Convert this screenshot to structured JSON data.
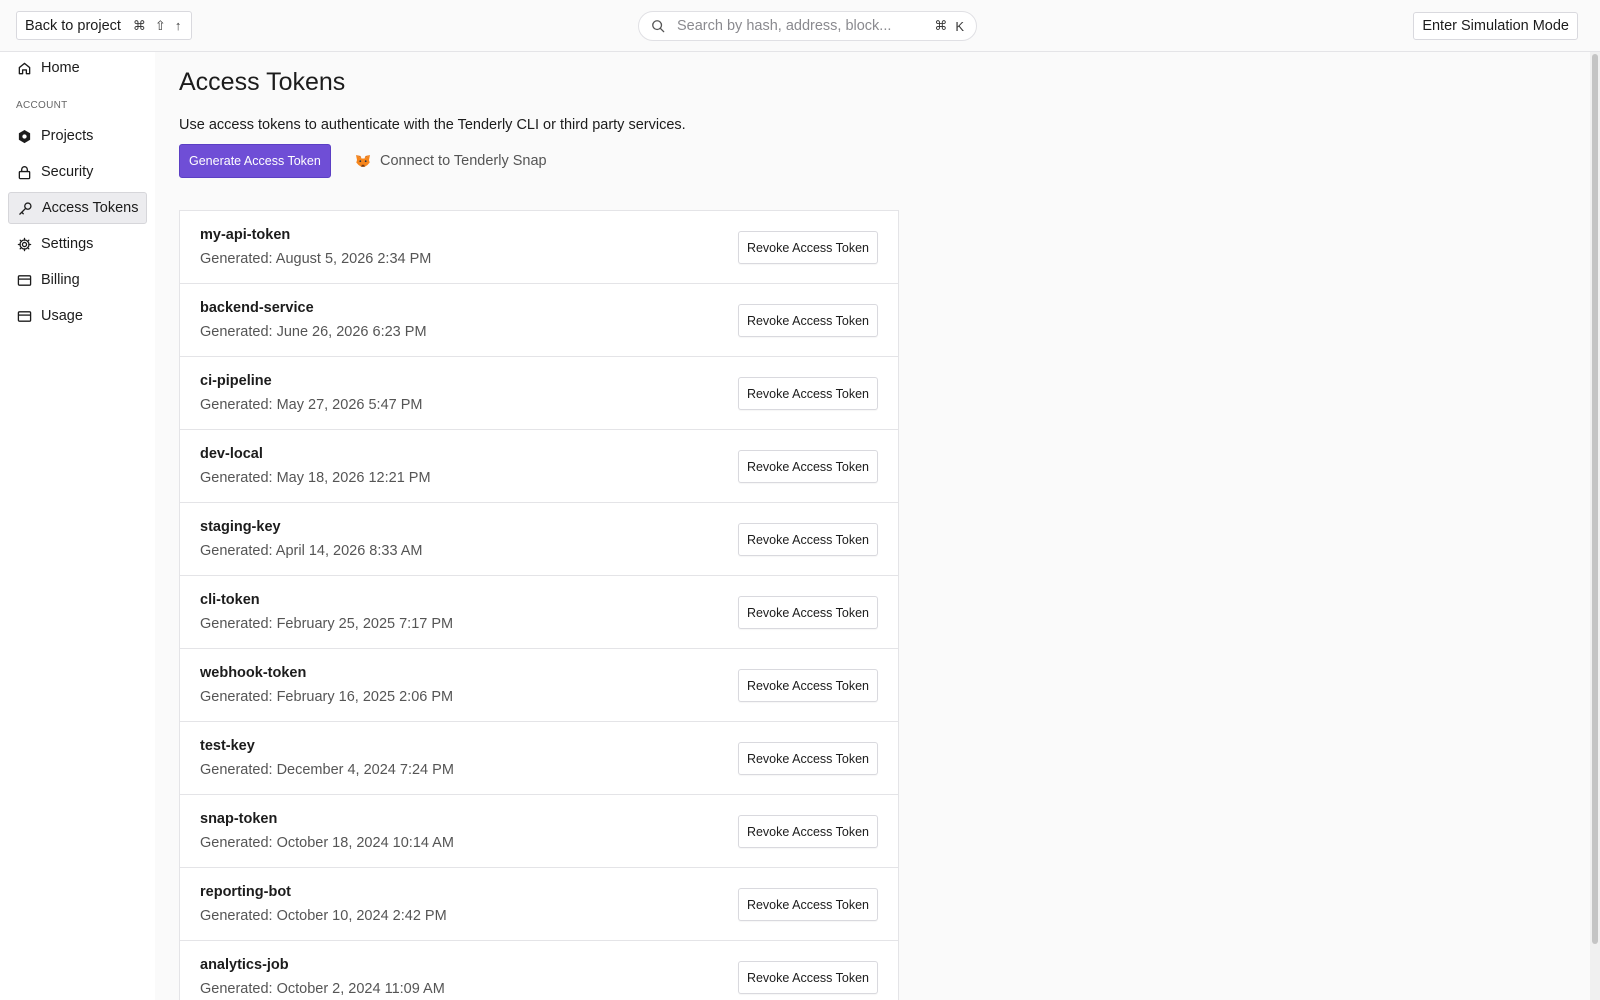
{
  "topbar": {
    "back_label": "Back to project",
    "back_shortcut": [
      "⌘",
      "⇧",
      "↑"
    ],
    "search_placeholder": "Search by hash, address, block...",
    "search_shortcut": [
      "⌘",
      "K"
    ],
    "simulation_label": "Enter Simulation Mode"
  },
  "sidebar": {
    "home": {
      "label": "Home",
      "icon": "home-icon"
    },
    "section_label": "ACCOUNT",
    "items": [
      {
        "label": "Projects",
        "icon": "hexagon-icon"
      },
      {
        "label": "Security",
        "icon": "lock-icon"
      },
      {
        "label": "Access Tokens",
        "icon": "key-icon",
        "active": true
      },
      {
        "label": "Settings",
        "icon": "gear-icon"
      },
      {
        "label": "Billing",
        "icon": "credit-card-icon"
      },
      {
        "label": "Usage",
        "icon": "credit-card-icon"
      }
    ]
  },
  "main": {
    "title": "Access Tokens",
    "description": "Use access tokens to authenticate with the Tenderly CLI or third party services.",
    "generate_label": "Generate Access Token",
    "snap_label": "Connect to Tenderly Snap",
    "revoke_label": "Revoke Access Token",
    "tokens": [
      {
        "name": "my-api-token",
        "generated": "Generated: August 5, 2026 2:34 PM"
      },
      {
        "name": "backend-service",
        "generated": "Generated: June 26, 2026 6:23 PM"
      },
      {
        "name": "ci-pipeline",
        "generated": "Generated: May 27, 2026 5:47 PM"
      },
      {
        "name": "dev-local",
        "generated": "Generated: May 18, 2026 12:21 PM"
      },
      {
        "name": "staging-key",
        "generated": "Generated: April 14, 2026 8:33 AM"
      },
      {
        "name": "cli-token",
        "generated": "Generated: February 25, 2025 7:17 PM"
      },
      {
        "name": "webhook-token",
        "generated": "Generated: February 16, 2025 2:06 PM"
      },
      {
        "name": "test-key",
        "generated": "Generated: December 4, 2024 7:24 PM"
      },
      {
        "name": "snap-token",
        "generated": "Generated: October 18, 2024 10:14 AM"
      },
      {
        "name": "reporting-bot",
        "generated": "Generated: October 10, 2024 2:42 PM"
      },
      {
        "name": "analytics-job",
        "generated": "Generated: October 2, 2024 11:09 AM"
      }
    ]
  },
  "colors": {
    "accent": "#6f4ed6",
    "background": "#fafafa",
    "sidebar_active": "#ececef"
  }
}
